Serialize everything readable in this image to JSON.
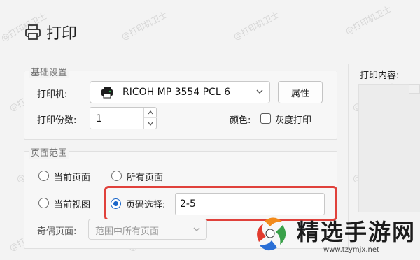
{
  "window": {
    "title": "打印",
    "icon": "printer-icon"
  },
  "basic_settings": {
    "legend": "基础设置",
    "printer_label": "打印机:",
    "printer_name": "RICOH MP 3554 PCL 6",
    "properties_button": "属性",
    "copies_label": "打印份数:",
    "copies_value": "1",
    "color_label": "颜色:",
    "grayscale_label": "灰度打印",
    "grayscale_checked": false
  },
  "page_range": {
    "legend": "页面范围",
    "options": [
      {
        "label": "当前页面",
        "checked": false
      },
      {
        "label": "所有页面",
        "checked": false
      },
      {
        "label": "当前视图",
        "checked": false
      },
      {
        "label": "页码选择:",
        "checked": true
      }
    ],
    "page_selection_value": "2-5",
    "odd_even_label": "奇偶页面:",
    "odd_even_value": "范围中所有页面"
  },
  "right": {
    "content_label": "打印内容:"
  },
  "watermark_text": "@打印机卫士",
  "brand": {
    "name": "精选手游网",
    "url": "www.tzymjx.net"
  },
  "colors": {
    "accent": "#1a66c9",
    "highlight": "#e0413b"
  }
}
